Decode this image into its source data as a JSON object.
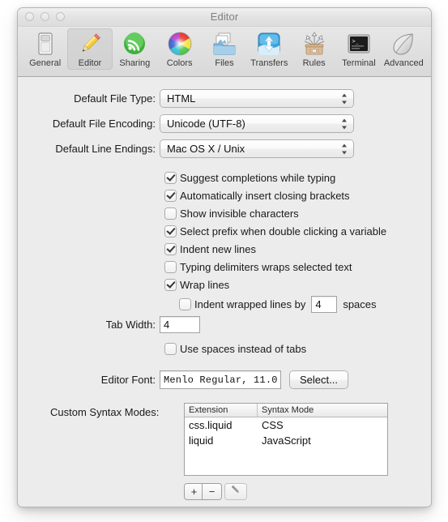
{
  "window": {
    "title": "Editor",
    "traffic_lights": [
      "close-button",
      "minimize-button",
      "zoom-button"
    ]
  },
  "toolbar": {
    "items": [
      {
        "label": "General",
        "icon": "general-icon",
        "selected": false
      },
      {
        "label": "Editor",
        "icon": "editor-icon",
        "selected": true
      },
      {
        "label": "Sharing",
        "icon": "sharing-icon",
        "selected": false
      },
      {
        "label": "Colors",
        "icon": "colors-icon",
        "selected": false
      },
      {
        "label": "Files",
        "icon": "files-icon",
        "selected": false
      },
      {
        "label": "Transfers",
        "icon": "transfers-icon",
        "selected": false
      },
      {
        "label": "Rules",
        "icon": "rules-icon",
        "selected": false
      },
      {
        "label": "Terminal",
        "icon": "terminal-icon",
        "selected": false
      },
      {
        "label": "Advanced",
        "icon": "advanced-icon",
        "selected": false
      }
    ]
  },
  "form": {
    "default_file_type": {
      "label": "Default File Type:",
      "value": "HTML"
    },
    "default_file_encoding": {
      "label": "Default File Encoding:",
      "value": "Unicode (UTF-8)"
    },
    "default_line_endings": {
      "label": "Default Line Endings:",
      "value": "Mac OS X / Unix"
    },
    "tab_width": {
      "label": "Tab Width:",
      "value": "4"
    },
    "editor_font": {
      "label": "Editor Font:",
      "value": "Menlo Regular, 11.0"
    },
    "select_font_button": "Select...",
    "custom_syntax_modes": {
      "label": "Custom Syntax Modes:"
    }
  },
  "checkboxes": [
    {
      "label": "Suggest completions while typing",
      "checked": true
    },
    {
      "label": "Automatically insert closing brackets",
      "checked": true
    },
    {
      "label": "Show invisible characters",
      "checked": false
    },
    {
      "label": "Select prefix when double clicking a variable",
      "checked": true
    },
    {
      "label": "Indent new lines",
      "checked": true
    },
    {
      "label": "Typing delimiters wraps selected text",
      "checked": false
    },
    {
      "label": "Wrap lines",
      "checked": true
    }
  ],
  "indent_wrapped": {
    "label": "Indent wrapped lines by",
    "checked": false,
    "value": "4",
    "suffix": "spaces"
  },
  "use_spaces": {
    "label": "Use spaces instead of tabs",
    "checked": false
  },
  "syntax_table": {
    "columns": [
      "Extension",
      "Syntax Mode"
    ],
    "rows": [
      [
        "css.liquid",
        "CSS"
      ],
      [
        "liquid",
        "JavaScript"
      ]
    ]
  },
  "table_buttons": {
    "add": "+",
    "remove": "−",
    "edit_icon": "pencil-icon"
  },
  "colors": {
    "window_bg": "#ececec",
    "toolbar_bg": "#e0e0e0",
    "title_text": "#808080",
    "field_bg": "#ffffff",
    "border": "#a9a9a9"
  }
}
